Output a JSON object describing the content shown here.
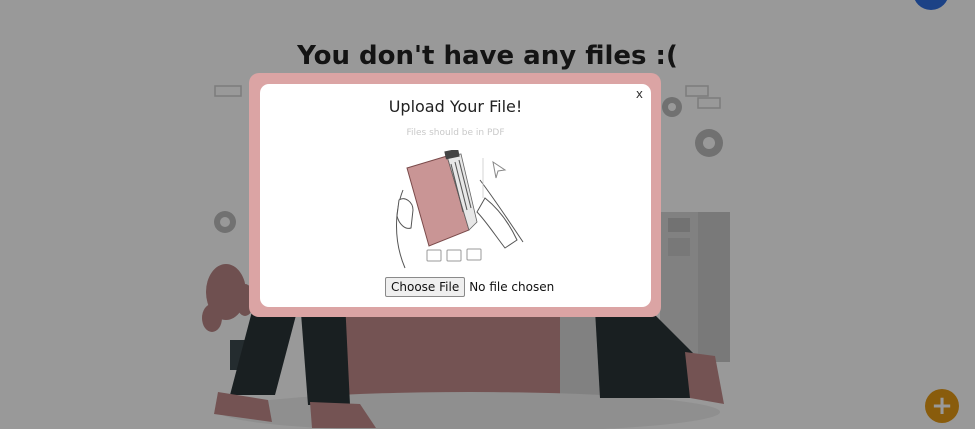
{
  "page": {
    "title": "You don't have any files :("
  },
  "fab": {
    "icon": "plus-icon",
    "glyph": "+"
  },
  "modal": {
    "close_label": "x",
    "title": "Upload Your File!",
    "subtitle": "Files should be in PDF",
    "choose_file_label": "Choose File",
    "file_status": "No file chosen"
  },
  "colors": {
    "accent_pink": "#dba4a4",
    "fab_orange": "#e59a14",
    "avatar_blue": "#2f6fe0"
  }
}
